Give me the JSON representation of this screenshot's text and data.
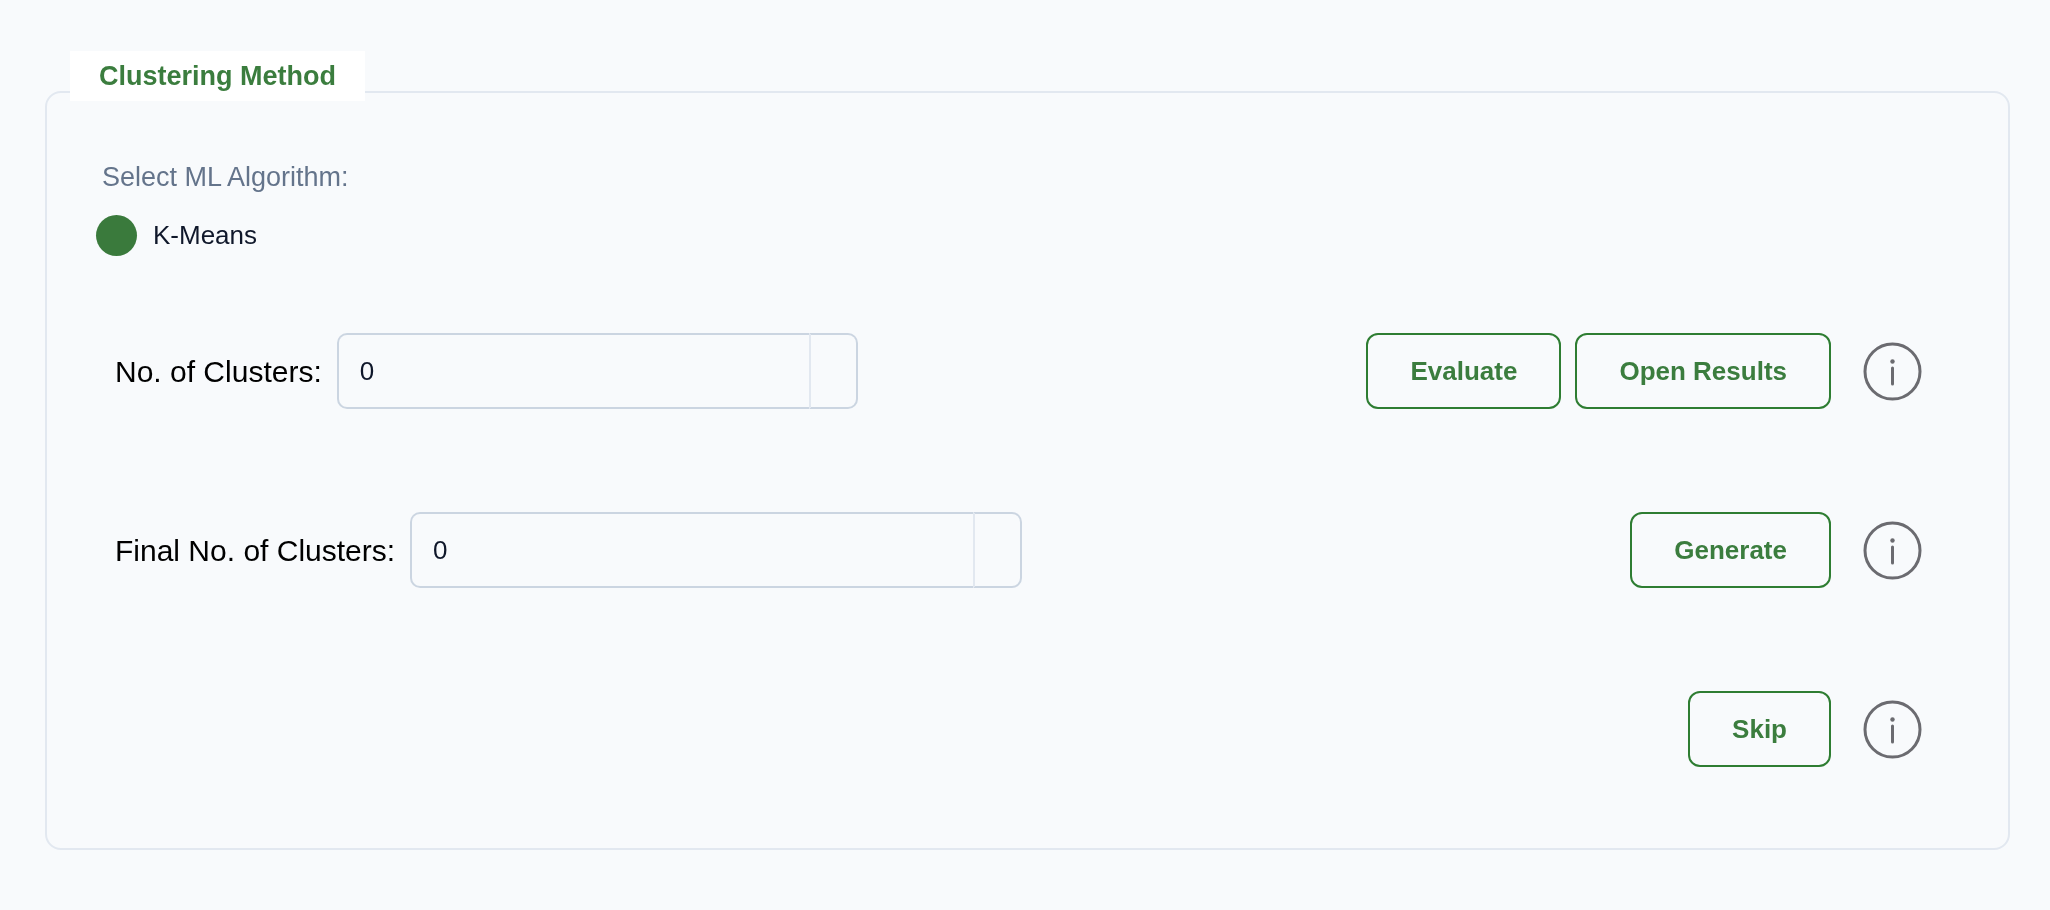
{
  "panel": {
    "legend": "Clustering Method",
    "prompt": "Select ML Algorithm:",
    "algorithms": [
      {
        "label": "K-Means",
        "selected": true
      }
    ],
    "rows": [
      {
        "label": "No. of Clusters:",
        "field_value": "0",
        "buttons": [
          "Evaluate",
          "Open Results"
        ]
      },
      {
        "label": "Final No. of Clusters:",
        "field_value": "0",
        "buttons": [
          "Generate"
        ]
      },
      {
        "buttons": [
          "Skip"
        ]
      }
    ]
  }
}
